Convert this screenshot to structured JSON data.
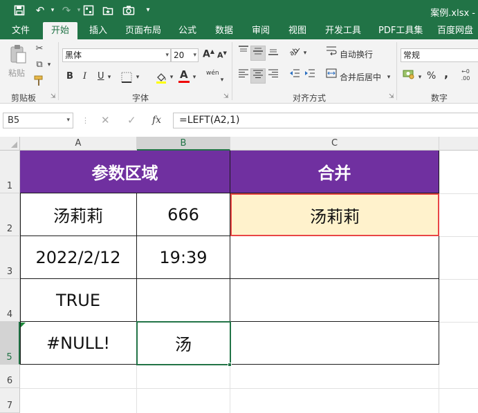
{
  "titlebar": {
    "filename": "案例.xlsx -",
    "save_icon": "save-icon",
    "undo_icon": "undo-icon",
    "redo_icon": "redo-icon"
  },
  "tabs": [
    {
      "label": "文件"
    },
    {
      "label": "开始"
    },
    {
      "label": "插入"
    },
    {
      "label": "页面布局"
    },
    {
      "label": "公式"
    },
    {
      "label": "数据"
    },
    {
      "label": "审阅"
    },
    {
      "label": "视图"
    },
    {
      "label": "开发工具"
    },
    {
      "label": "PDF工具集"
    },
    {
      "label": "百度网盘"
    }
  ],
  "ribbon": {
    "clipboard": {
      "paste_label": "粘贴",
      "group_label": "剪贴板"
    },
    "font": {
      "font_name": "黑体",
      "font_size": "20",
      "bold": "B",
      "italic": "I",
      "underline": "U",
      "font_color": "A",
      "phonetic": "wén",
      "grow": "A",
      "shrink": "A",
      "group_label": "字体"
    },
    "alignment": {
      "wrap_text": "自动换行",
      "merge_center": "合并后居中",
      "group_label": "对齐方式"
    },
    "number": {
      "format": "常规",
      "percent": "%",
      "comma": ",",
      "group_label": "数字"
    }
  },
  "formula_bar": {
    "name_box": "B5",
    "fx": "fx",
    "formula": "=LEFT(A2,1)"
  },
  "columns": [
    "A",
    "B",
    "C"
  ],
  "rows": [
    "1",
    "2",
    "3",
    "4",
    "5",
    "6",
    "7"
  ],
  "cells": {
    "a1": "参数区域",
    "c1": "合并",
    "a2": "汤莉莉",
    "b2": "666",
    "c2": "汤莉莉",
    "a3": "2022/2/12",
    "b3": "19:39",
    "a4": "TRUE",
    "a5": "#NULL!",
    "b5": "汤"
  },
  "colors": {
    "ribbon_green": "#217346",
    "header_fill": "#7030a0",
    "highlight_fill": "#fff2cc",
    "highlight_border": "#e84545"
  }
}
